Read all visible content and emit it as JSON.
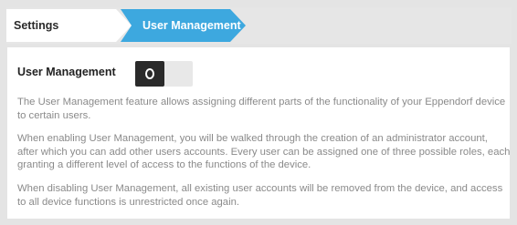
{
  "breadcrumb": {
    "items": [
      "Settings",
      "User Management"
    ]
  },
  "setting": {
    "label": "User Management",
    "toggle_state": "off"
  },
  "description": {
    "p1": "The User Management feature allows assigning different parts of the functionality of your Eppendorf device to certain users.",
    "p2": "When enabling User Management, you will be walked through the creation of an administrator account, after which you can add other users accounts. Every user can be assigned one of three possible roles, each granting a different level of access to the functions of the device.",
    "p3": "When disabling User Management, all existing user accounts will be removed from the device, and access to all device functions is unrestricted once again."
  },
  "colors": {
    "accent": "#3da8df",
    "background": "#e4e4e4",
    "text_muted": "#8a8a8a"
  }
}
